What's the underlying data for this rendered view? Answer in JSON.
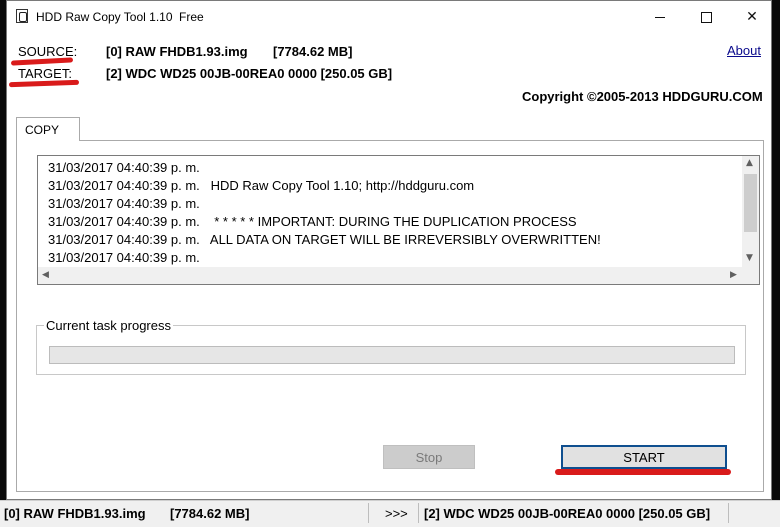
{
  "window": {
    "title": "HDD Raw Copy Tool 1.10",
    "edition": "Free",
    "minimize_glyph": "",
    "close_glyph": "✕"
  },
  "source": {
    "label": "SOURCE:",
    "value": "[0]  RAW FHDB1.93.img",
    "size": "[7784.62 MB]"
  },
  "target": {
    "label": "TARGET:",
    "value": "[2]  WDC WD25 00JB-00REA0   0000   [250.05 GB]"
  },
  "about_label": "About",
  "copyright": "Copyright ©2005-2013 HDDGURU.COM",
  "tabs": [
    {
      "label": "COPY"
    }
  ],
  "log": [
    "31/03/2017 04:40:39 p. m.",
    "31/03/2017 04:40:39 p. m.   HDD Raw Copy Tool 1.10; http://hddguru.com",
    "31/03/2017 04:40:39 p. m.",
    "31/03/2017 04:40:39 p. m.    * * * * * IMPORTANT: DURING THE DUPLICATION PROCESS",
    "31/03/2017 04:40:39 p. m.   ALL DATA ON TARGET WILL BE IRREVERSIBLY OVERWRITTEN!",
    "31/03/2017 04:40:39 p. m."
  ],
  "progress": {
    "label": "Current task progress",
    "value": 0
  },
  "buttons": {
    "stop": "Stop",
    "start": "START"
  },
  "statusbar": {
    "source": "[0]  RAW FHDB1.93.img",
    "source_size": "[7784.62 MB]",
    "arrows": ">>>",
    "target": "[2]  WDC WD25 00JB-00REA0   0000   [250.05 GB]"
  },
  "colors": {
    "annotation_red": "#d91b1b",
    "start_border": "#0f4f8f",
    "progress_fill": "#06b025"
  }
}
